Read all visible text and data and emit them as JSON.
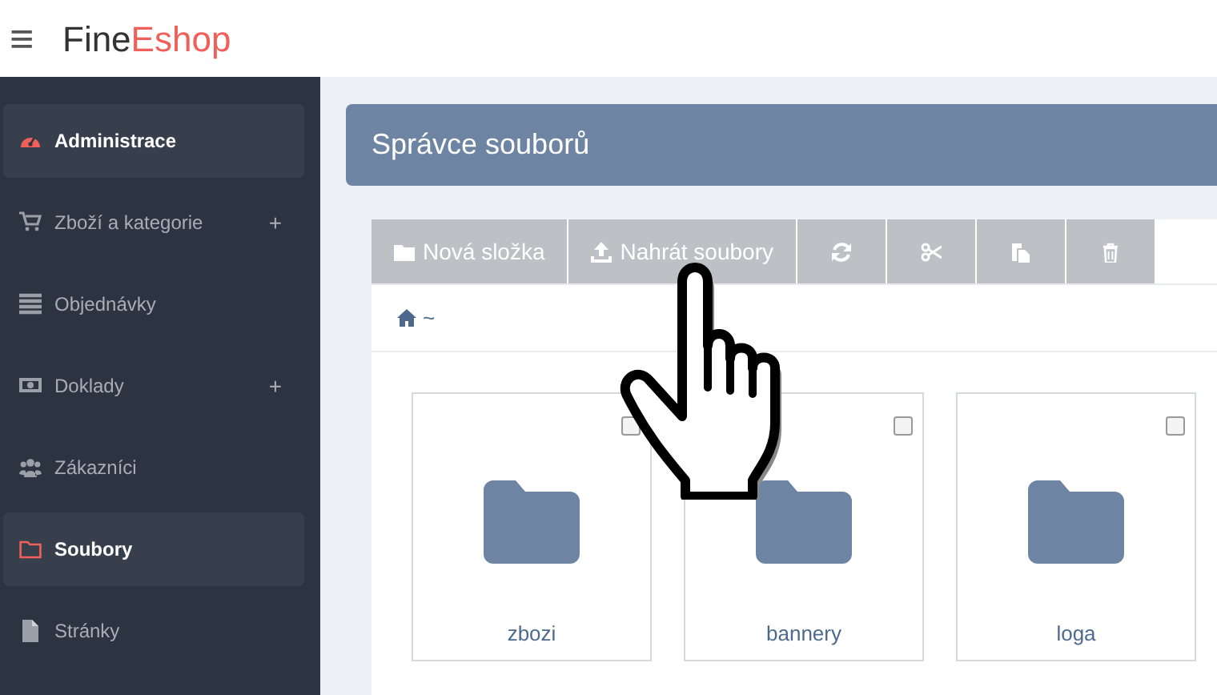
{
  "header": {
    "menu_icon": "≡",
    "brand": "Fine",
    "brand_accent": "Eshop"
  },
  "sidebar": {
    "items": [
      {
        "label": "Administrace",
        "kind": "gauge",
        "selected": true
      },
      {
        "label": "Zboží a kategorie",
        "kind": "cart",
        "selected": false,
        "expand": "+"
      },
      {
        "label": "Objednávky",
        "kind": "list",
        "selected": false
      },
      {
        "label": "Doklady",
        "kind": "money",
        "selected": false,
        "expand": "+"
      },
      {
        "label": "Zákazníci",
        "kind": "users",
        "selected": false
      },
      {
        "label": "Soubory",
        "kind": "folder",
        "selected": true
      },
      {
        "label": "Stránky",
        "kind": "file",
        "selected": false
      }
    ]
  },
  "page_title": "Správce souborů",
  "toolbar": [
    {
      "kind": "folder",
      "label": "Nová složka"
    },
    {
      "kind": "upload",
      "label": "Nahrát soubory"
    },
    {
      "kind": "refresh"
    },
    {
      "kind": "scissors"
    },
    {
      "kind": "paste"
    },
    {
      "kind": "trash"
    }
  ],
  "breadcrumb": "~",
  "folders": [
    {
      "name": "zbozi",
      "checked": false
    },
    {
      "name": "bannery",
      "checked": false
    },
    {
      "name": "loga",
      "checked": false
    }
  ]
}
